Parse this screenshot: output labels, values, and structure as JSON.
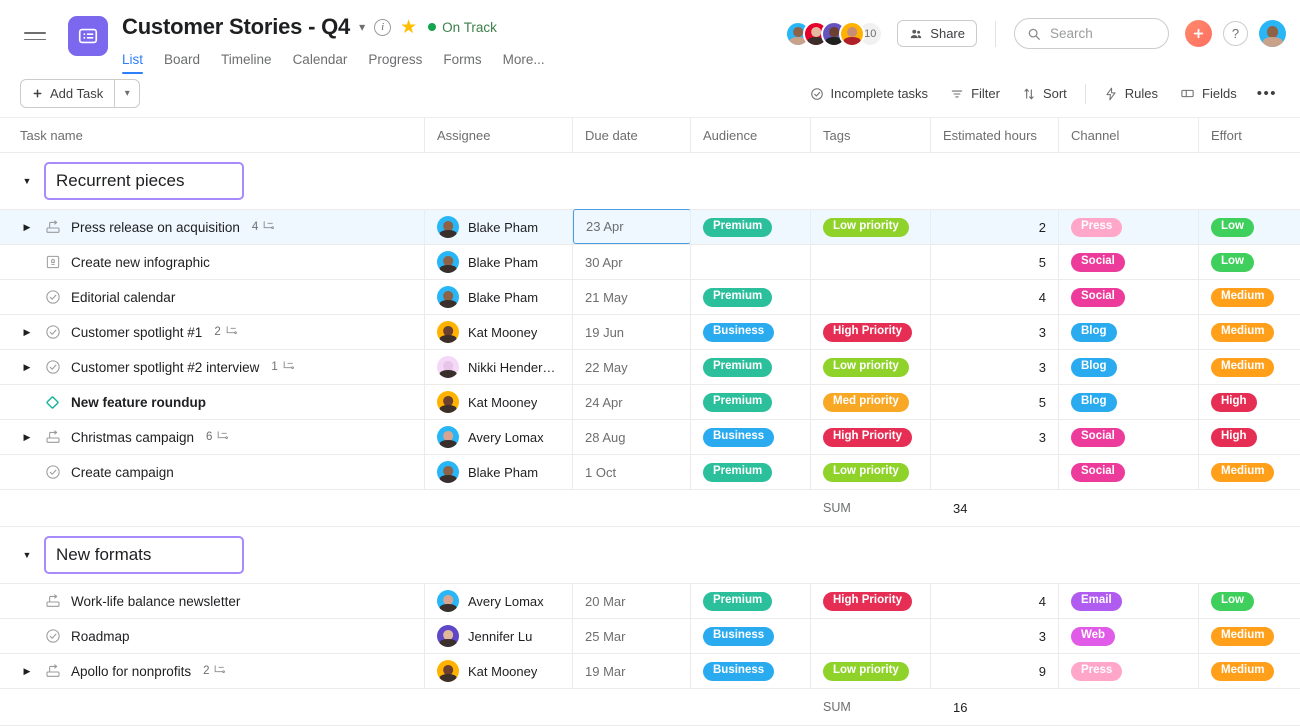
{
  "header": {
    "menu_icon": "hamburger-icon",
    "project_logo_icon": "list-project-icon",
    "title": "Customer Stories - Q4",
    "dropdown_icon": "chevron-down-icon",
    "info_icon": "info-icon",
    "star_icon": "star-icon",
    "status": "On Track",
    "status_color": "#14a44d",
    "tabs": [
      {
        "label": "List",
        "active": true
      },
      {
        "label": "Board",
        "active": false
      },
      {
        "label": "Timeline",
        "active": false
      },
      {
        "label": "Calendar",
        "active": false
      },
      {
        "label": "Progress",
        "active": false
      },
      {
        "label": "Forms",
        "active": false
      },
      {
        "label": "More...",
        "active": false
      }
    ],
    "member_count": "10",
    "share_label": "Share",
    "share_icon": "people-icon",
    "search_placeholder": "Search",
    "search_icon": "search-icon",
    "plus_icon": "plus-icon",
    "help_icon": "question-icon",
    "account_icon": "account-avatar"
  },
  "toolbar": {
    "add_task_label": "Add Task",
    "add_task_plus_icon": "plus-icon",
    "add_task_caret_icon": "chevron-down-icon",
    "incomplete_label": "Incomplete tasks",
    "incomplete_icon": "check-circle-icon",
    "filter_label": "Filter",
    "filter_icon": "filter-icon",
    "sort_label": "Sort",
    "sort_icon": "sort-arrows-icon",
    "rules_label": "Rules",
    "rules_icon": "lightning-icon",
    "fields_label": "Fields",
    "fields_icon": "fields-icon",
    "more_icon": "ellipsis-icon"
  },
  "table": {
    "columns": [
      "Task name",
      "Assignee",
      "Due date",
      "Audience",
      "Tags",
      "Estimated hours",
      "Channel",
      "Effort"
    ],
    "sum_label": "SUM"
  },
  "colors": {
    "premium": "#2bbf9b",
    "business": "#2aabf0",
    "low_priority": "#8ed22a",
    "med_priority": "#f9a825",
    "high_priority": "#e62e55",
    "press": "#ffa6c9",
    "social": "#ed3b9b",
    "blog": "#2aabf0",
    "email": "#b05cf0",
    "web": "#e05ce8",
    "effort_low": "#3ecf5c",
    "effort_medium": "#ff9f1a",
    "effort_high": "#e62e55",
    "accent_blue": "#2d7ff9",
    "section_outline": "#a78bfa"
  },
  "sections": [
    {
      "name": "Recurrent pieces",
      "caret_icon": "caret-down-icon",
      "sum_value": "34",
      "tasks": [
        {
          "caret": true,
          "icon": "approval-task-icon",
          "name": "Press release on acquisition",
          "subtask_count": "4",
          "bold": false,
          "highlighted": true,
          "assignee": "Blake Pham",
          "avatar_bg": "#29b6f6",
          "avatar_skin": "#8d6247",
          "due": "23 Apr",
          "due_selected": true,
          "audience": "Premium",
          "audience_color": "#2bbf9b",
          "tag": "Low priority",
          "tag_color": "#8ed22a",
          "hours": "2",
          "channel": "Press",
          "channel_color": "#ffa6c9",
          "effort": "Low",
          "effort_color": "#3ecf5c"
        },
        {
          "caret": false,
          "icon": "milestone-doc-icon",
          "name": "Create new infographic",
          "subtask_count": "",
          "bold": false,
          "highlighted": false,
          "assignee": "Blake Pham",
          "avatar_bg": "#29b6f6",
          "avatar_skin": "#8d6247",
          "due": "30 Apr",
          "due_selected": false,
          "audience": "",
          "audience_color": "",
          "tag": "",
          "tag_color": "",
          "hours": "5",
          "channel": "Social",
          "channel_color": "#ed3b9b",
          "effort": "Low",
          "effort_color": "#3ecf5c"
        },
        {
          "caret": false,
          "icon": "check-circle-icon",
          "name": "Editorial calendar",
          "subtask_count": "",
          "bold": false,
          "highlighted": false,
          "assignee": "Blake Pham",
          "avatar_bg": "#29b6f6",
          "avatar_skin": "#8d6247",
          "due": "21 May",
          "due_selected": false,
          "audience": "Premium",
          "audience_color": "#2bbf9b",
          "tag": "",
          "tag_color": "",
          "hours": "4",
          "channel": "Social",
          "channel_color": "#ed3b9b",
          "effort": "Medium",
          "effort_color": "#ff9f1a"
        },
        {
          "caret": true,
          "icon": "check-circle-icon",
          "name": "Customer spotlight #1",
          "subtask_count": "2",
          "bold": false,
          "highlighted": false,
          "assignee": "Kat Mooney",
          "avatar_bg": "#ffb300",
          "avatar_skin": "#6b4030",
          "due": "19 Jun",
          "due_selected": false,
          "audience": "Business",
          "audience_color": "#2aabf0",
          "tag": "High Priority",
          "tag_color": "#e62e55",
          "hours": "3",
          "channel": "Blog",
          "channel_color": "#2aabf0",
          "effort": "Medium",
          "effort_color": "#ff9f1a"
        },
        {
          "caret": true,
          "icon": "check-circle-icon",
          "name": "Customer spotlight #2 interview",
          "subtask_count": "1",
          "bold": false,
          "highlighted": false,
          "assignee": "Nikki Henderson ...",
          "avatar_bg": "#f3d9f7",
          "avatar_skin": "#e8c4e8",
          "due": "22 May",
          "due_selected": false,
          "audience": "Premium",
          "audience_color": "#2bbf9b",
          "tag": "Low priority",
          "tag_color": "#8ed22a",
          "hours": "3",
          "channel": "Blog",
          "channel_color": "#2aabf0",
          "effort": "Medium",
          "effort_color": "#ff9f1a"
        },
        {
          "caret": false,
          "icon": "milestone-diamond-icon",
          "name": "New feature roundup",
          "subtask_count": "",
          "bold": true,
          "highlighted": false,
          "assignee": "Kat Mooney",
          "avatar_bg": "#ffb300",
          "avatar_skin": "#6b4030",
          "due": "24 Apr",
          "due_selected": false,
          "audience": "Premium",
          "audience_color": "#2bbf9b",
          "tag": "Med priority",
          "tag_color": "#f9a825",
          "hours": "5",
          "channel": "Blog",
          "channel_color": "#2aabf0",
          "effort": "High",
          "effort_color": "#e62e55"
        },
        {
          "caret": true,
          "icon": "approval-task-icon",
          "name": "Christmas campaign",
          "subtask_count": "6",
          "bold": false,
          "highlighted": false,
          "assignee": "Avery Lomax",
          "avatar_bg": "#29b6f6",
          "avatar_skin": "#d8a48f",
          "due": "28 Aug",
          "due_selected": false,
          "audience": "Business",
          "audience_color": "#2aabf0",
          "tag": "High Priority",
          "tag_color": "#e62e55",
          "hours": "3",
          "channel": "Social",
          "channel_color": "#ed3b9b",
          "effort": "High",
          "effort_color": "#e62e55"
        },
        {
          "caret": false,
          "icon": "check-circle-icon",
          "name": "Create campaign",
          "subtask_count": "",
          "bold": false,
          "highlighted": false,
          "assignee": "Blake Pham",
          "avatar_bg": "#29b6f6",
          "avatar_skin": "#8d6247",
          "due": "1 Oct",
          "due_selected": false,
          "audience": "Premium",
          "audience_color": "#2bbf9b",
          "tag": "Low priority",
          "tag_color": "#8ed22a",
          "hours": "",
          "channel": "Social",
          "channel_color": "#ed3b9b",
          "effort": "Medium",
          "effort_color": "#ff9f1a"
        }
      ]
    },
    {
      "name": "New formats",
      "caret_icon": "caret-down-icon",
      "sum_value": "16",
      "tasks": [
        {
          "caret": false,
          "icon": "approval-task-icon",
          "name": "Work-life balance newsletter",
          "subtask_count": "",
          "bold": false,
          "highlighted": false,
          "assignee": "Avery Lomax",
          "avatar_bg": "#29b6f6",
          "avatar_skin": "#d8a48f",
          "due": "20 Mar",
          "due_selected": false,
          "audience": "Premium",
          "audience_color": "#2bbf9b",
          "tag": "High Priority",
          "tag_color": "#e62e55",
          "hours": "4",
          "channel": "Email",
          "channel_color": "#b05cf0",
          "effort": "Low",
          "effort_color": "#3ecf5c"
        },
        {
          "caret": false,
          "icon": "check-circle-icon",
          "name": "Roadmap",
          "subtask_count": "",
          "bold": false,
          "highlighted": false,
          "assignee": "Jennifer Lu",
          "avatar_bg": "#5e48c8",
          "avatar_skin": "#e0b89b",
          "due": "25 Mar",
          "due_selected": false,
          "audience": "Business",
          "audience_color": "#2aabf0",
          "tag": "",
          "tag_color": "",
          "hours": "3",
          "channel": "Web",
          "channel_color": "#e05ce8",
          "effort": "Medium",
          "effort_color": "#ff9f1a"
        },
        {
          "caret": true,
          "icon": "approval-task-icon",
          "name": "Apollo for nonprofits",
          "subtask_count": "2",
          "bold": false,
          "highlighted": false,
          "assignee": "Kat Mooney",
          "avatar_bg": "#ffb300",
          "avatar_skin": "#6b4030",
          "due": "19 Mar",
          "due_selected": false,
          "audience": "Business",
          "audience_color": "#2aabf0",
          "tag": "Low priority",
          "tag_color": "#8ed22a",
          "hours": "9",
          "channel": "Press",
          "channel_color": "#ffa6c9",
          "effort": "Medium",
          "effort_color": "#ff9f1a"
        }
      ]
    }
  ],
  "header_avatars": [
    {
      "bg": "#29b6f6",
      "skin": "#8d6247"
    },
    {
      "bg": "#e4002b",
      "skin": "#e3b9a0"
    },
    {
      "bg": "#6554c0",
      "skin": "#6b4030"
    },
    {
      "bg": "#ffb300",
      "skin": "#c98f74"
    }
  ]
}
